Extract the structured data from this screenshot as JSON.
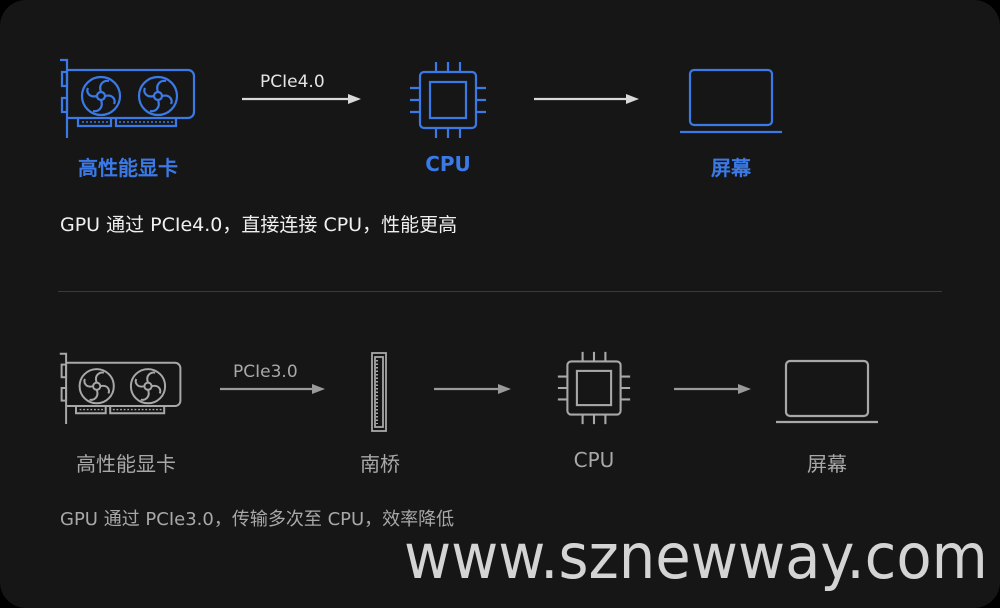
{
  "colors": {
    "accent": "#3b7ae6",
    "muted": "#a8a8a8",
    "arrow_top": "#d9d9d9",
    "arrow_bottom": "#9a9a9a",
    "background": "#161616"
  },
  "top_flow": {
    "gpu_label": "高性能显卡",
    "link_label": "PCIe4.0",
    "cpu_label": "CPU",
    "screen_label": "屏幕",
    "description": "GPU 通过 PCIe4.0，直接连接 CPU，性能更高",
    "icons": [
      "graphics-card-icon",
      "arrow-right-icon",
      "cpu-chip-icon",
      "arrow-right-icon",
      "laptop-screen-icon"
    ]
  },
  "bottom_flow": {
    "gpu_label": "高性能显卡",
    "link_label": "PCIe3.0",
    "southbridge_label": "南桥",
    "cpu_label": "CPU",
    "screen_label": "屏幕",
    "description": "GPU 通过 PCIe3.0，传输多次至 CPU，效率降低",
    "icons": [
      "graphics-card-icon",
      "arrow-right-icon",
      "southbridge-chip-icon",
      "arrow-right-icon",
      "cpu-chip-icon",
      "arrow-right-icon",
      "laptop-screen-icon"
    ]
  },
  "watermark": "www.sznewway.com"
}
